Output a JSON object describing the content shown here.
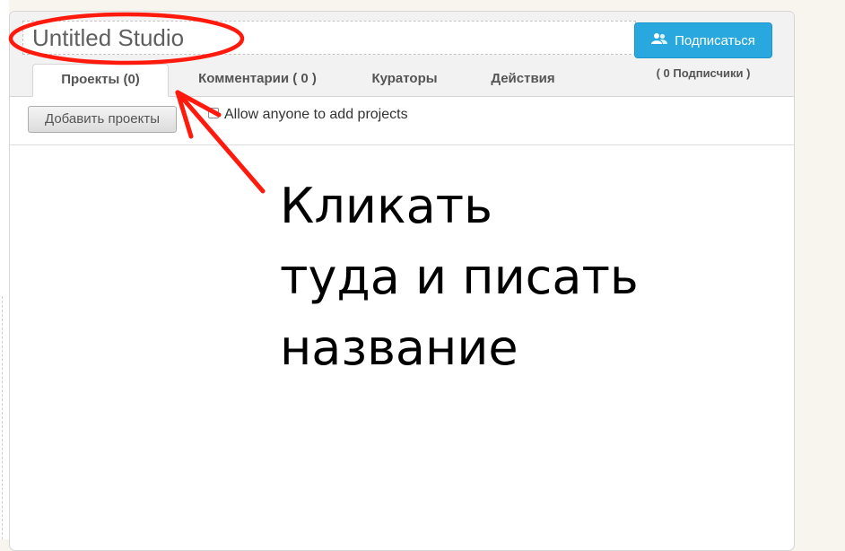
{
  "studio": {
    "title": "Untitled Studio",
    "subscribe_label": "Подписаться",
    "subscriber_count": "( 0 Подписчики )"
  },
  "tabs": [
    {
      "label": "Проекты (0)",
      "active": true
    },
    {
      "label": "Комментарии ( 0 )",
      "active": false
    },
    {
      "label": "Кураторы",
      "active": false
    },
    {
      "label": "Действия",
      "active": false
    }
  ],
  "toolbar": {
    "add_projects_label": "Добавить проекты",
    "allow_anyone_label": "Allow anyone to add projects",
    "allow_anyone_checked": false
  },
  "annotation": {
    "lines": [
      "Кликать",
      "туда и писать",
      "название"
    ],
    "color": "#ff1a0d"
  },
  "icons": {
    "subscribe": "users-icon"
  },
  "colors": {
    "subscribe_button": "#29a8e0",
    "annotation_marker": "#ff1a0d"
  }
}
